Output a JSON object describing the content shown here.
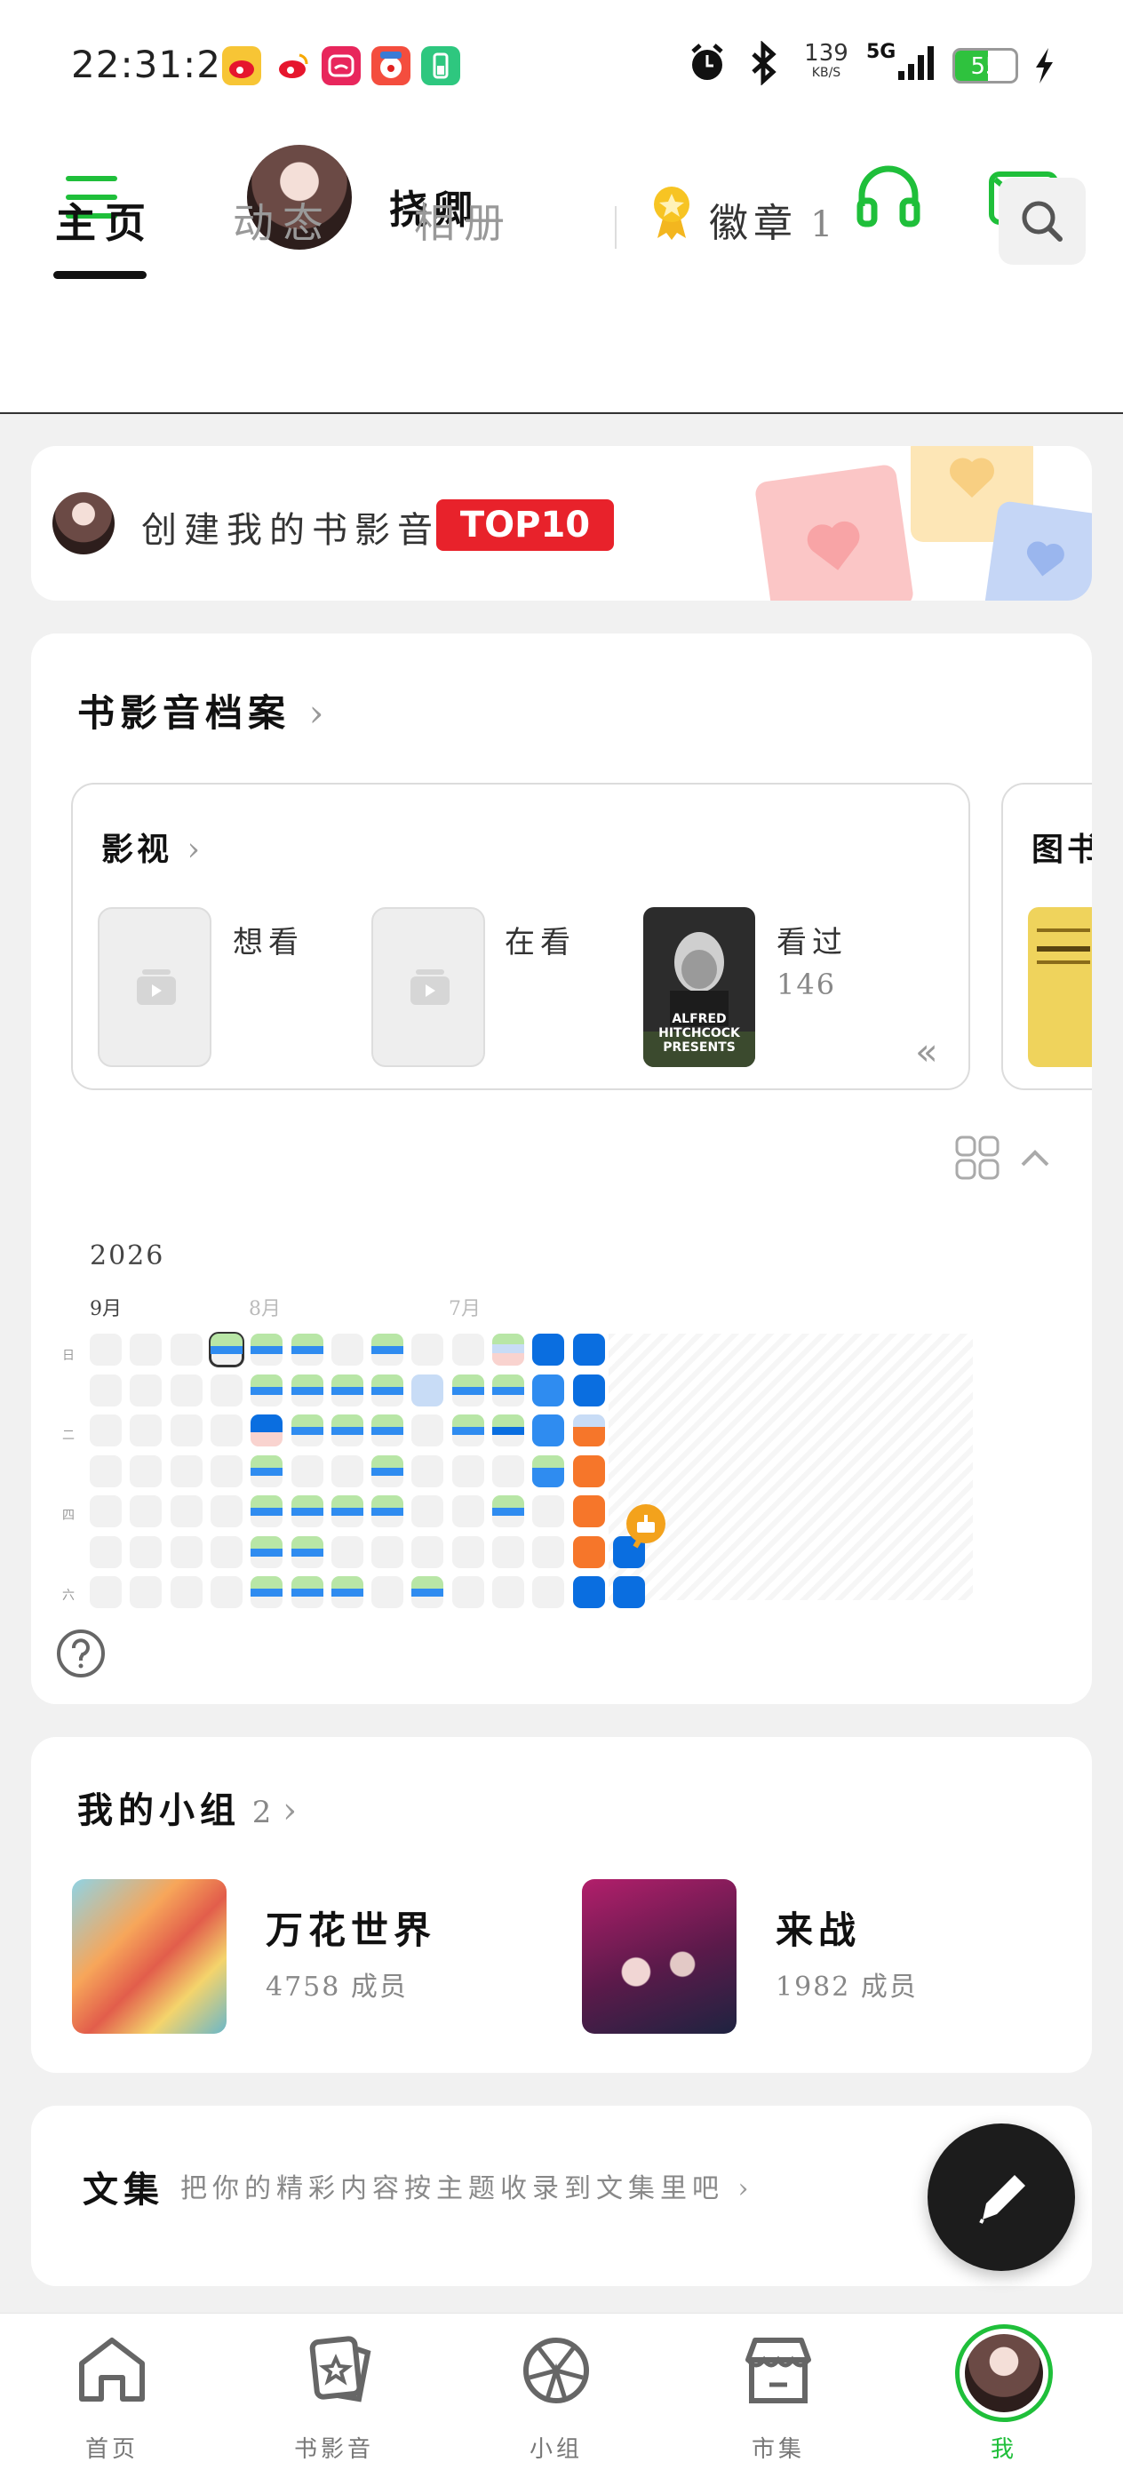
{
  "status_bar": {
    "time": "22:31:27",
    "net_speed": "139",
    "net_unit": "KB/S",
    "network": "5G",
    "battery": "55"
  },
  "header": {
    "username": "挠卿"
  },
  "tabs": [
    {
      "label": "主页"
    },
    {
      "label": "动态"
    },
    {
      "label": "相册"
    }
  ],
  "badge": {
    "label": "徽章",
    "count": "1"
  },
  "top10": {
    "text": "创建我的书影音",
    "tag": "TOP10"
  },
  "archive": {
    "title": "书影音档案",
    "movies": {
      "title": "影视",
      "want": "想看",
      "watching": "在看",
      "watched": "看过",
      "watched_count": "146",
      "poster_text": "ALFRED HITCHCOCK PRESENTS"
    },
    "books": {
      "title": "图书"
    },
    "year": "2026",
    "months": [
      "9月",
      "8月",
      "7月"
    ],
    "weekdays": [
      "日",
      "二",
      "四",
      "六"
    ]
  },
  "groups": {
    "title": "我的小组",
    "count": "2",
    "items": [
      {
        "name": "万花世界",
        "members": "4758 成员"
      },
      {
        "name": "来战",
        "members": "1982 成员"
      }
    ]
  },
  "collection": {
    "title": "文集",
    "hint": "把你的精彩内容按主题收录到文集里吧"
  },
  "bottom_nav": [
    {
      "label": "首页",
      "icon": "home-icon"
    },
    {
      "label": "书影音",
      "icon": "cards-icon"
    },
    {
      "label": "小组",
      "icon": "group-icon"
    },
    {
      "label": "市集",
      "icon": "shop-icon"
    },
    {
      "label": "我",
      "icon": "avatar"
    }
  ],
  "colors": {
    "accent": "#1fbf3a",
    "dark_blue": "#0a6ee0",
    "blue": "#2f8cf0",
    "orange": "#f6762a",
    "light_green": "#b8e6a6",
    "light_blue": "#c8dcf6"
  }
}
